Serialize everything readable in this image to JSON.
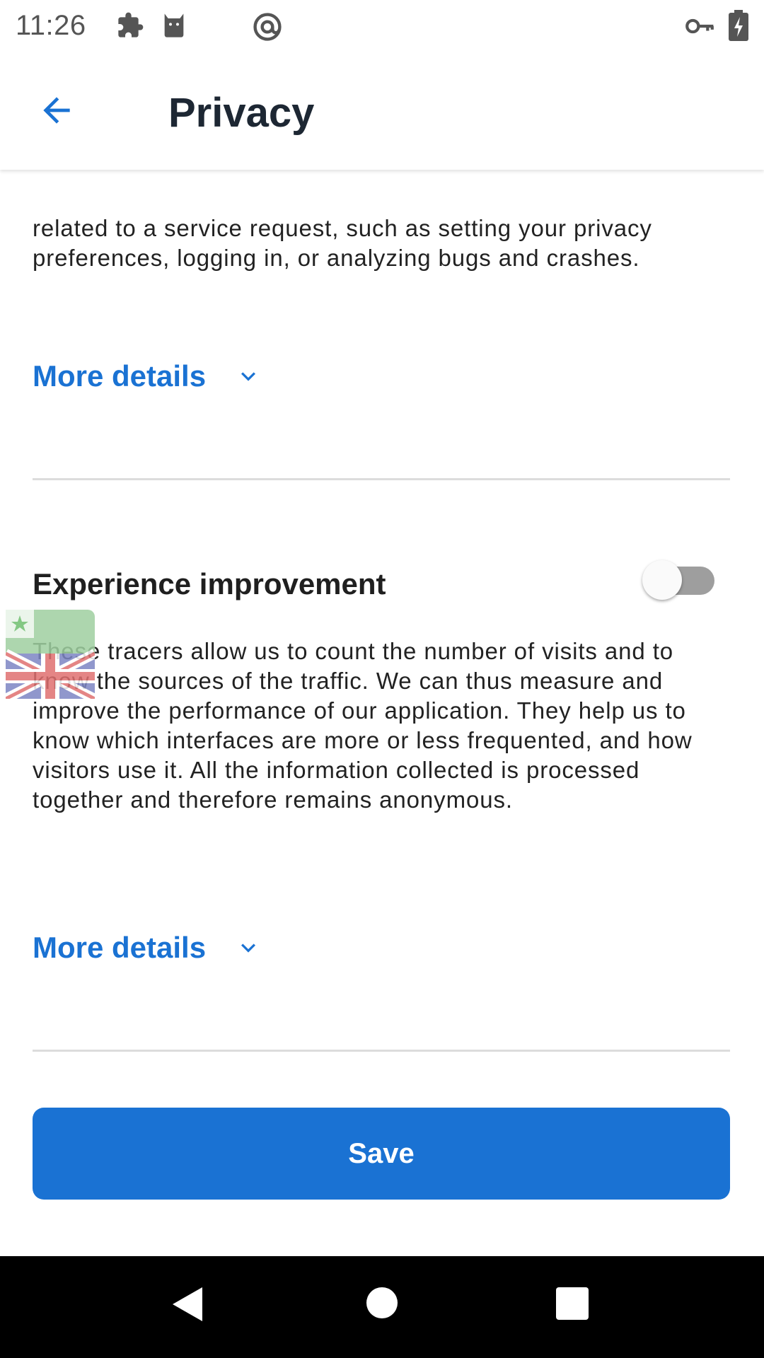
{
  "status_bar": {
    "time": "11:26",
    "icons": [
      "puzzle-icon",
      "cat-icon",
      "at-sign-icon",
      "key-icon",
      "battery-charging-icon"
    ]
  },
  "app_bar": {
    "title": "Privacy",
    "back_icon": "arrow-back-icon"
  },
  "sections": {
    "intro_text": "related to a service request, such as setting your privacy preferences, logging in, or analyzing bugs and crashes.",
    "more_details_1": "More details",
    "experience_title": "Experience improvement",
    "experience_toggle_on": false,
    "experience_text": "These tracers allow us to count the number of visits and to know the sources of the traffic. We can thus measure and improve the performance of our application. They help us to know which interfaces are more or less frequented, and how visitors use it. All the information collected is processed together and therefore remains anonymous.",
    "more_details_2": "More details"
  },
  "save_label": "Save",
  "colors": {
    "accent": "#1a72d3",
    "title": "#1d2733",
    "toggle_off_track": "#9e9e9e"
  },
  "nav_bar": {
    "icons": [
      "back-triangle-icon",
      "home-circle-icon",
      "recents-square-icon"
    ]
  }
}
